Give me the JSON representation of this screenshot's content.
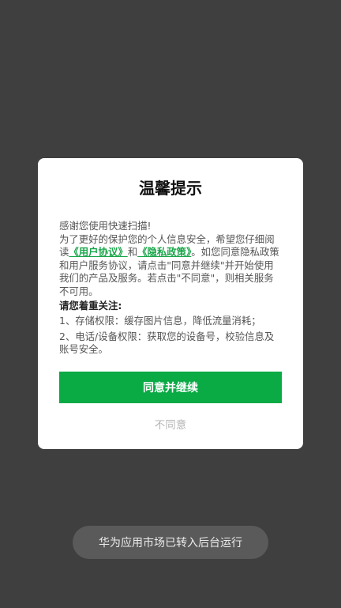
{
  "dialog": {
    "title": "温馨提示",
    "line1": "感谢您使用快速扫描!",
    "intro_text": "为了更好的保护您的个人信息安全，希望您仔细阅读",
    "user_agreement_link": "《用户协议》",
    "and_text": "和",
    "privacy_policy_link": "《隐私政策》",
    "rest_text": "。如您同意隐私政策和用户服务协议，请点击\"同意并继续\"并开始使用我们的产品及服务。若点击\"不同意\"，则相关服务不可用。",
    "attention_heading": "请您着重关注:",
    "permission_1": "1、存储权限：缓存图片信息，降低流量消耗；",
    "permission_2": "2、电话/设备权限：获取您的设备号，校验信息及账号安全。",
    "agree_button": "同意并继续",
    "disagree_button": "不同意"
  },
  "toast": {
    "text": "华为应用市场已转入后台运行"
  },
  "colors": {
    "background": "#3f3f3f",
    "accent": "#0aaa45",
    "link": "#1aa64a"
  }
}
